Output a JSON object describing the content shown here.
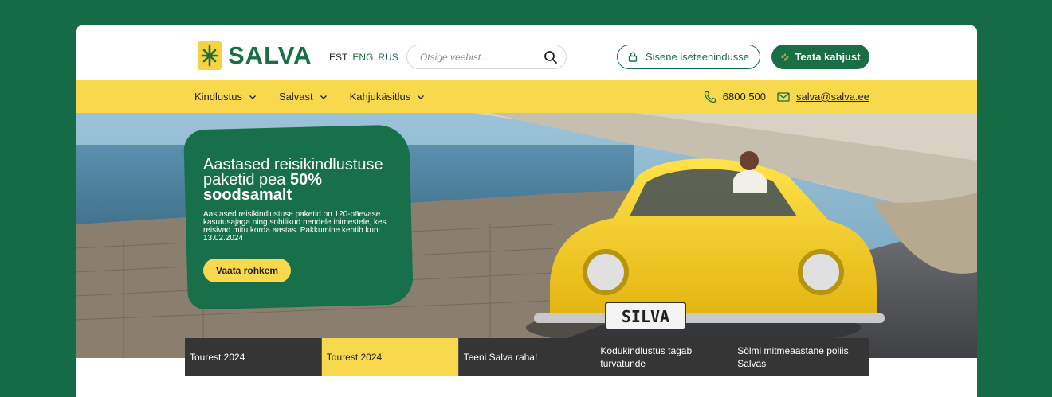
{
  "brand": {
    "name": "SALVA"
  },
  "languages": [
    {
      "label": "EST",
      "active": true
    },
    {
      "label": "ENG",
      "active": false
    },
    {
      "label": "RUS",
      "active": false
    }
  ],
  "search": {
    "placeholder": "Otsige veebist..."
  },
  "header_buttons": {
    "login": "Sisene iseteenindusse",
    "claim": "Teata kahjust"
  },
  "nav": {
    "items": [
      {
        "label": "Kindlustus"
      },
      {
        "label": "Salvast"
      },
      {
        "label": "Kahjukäsitlus"
      }
    ],
    "phone": "6800 500",
    "email": "salva@salva.ee"
  },
  "hero": {
    "title_line1": "Aastased reisikindlustuse",
    "title_line2": "paketid pea",
    "title_bold1": "50%",
    "title_bold2": "soodsamalt",
    "body": "Aastased reisikindlustuse paketid on 120-päevase kasutusajaga ning sobilikud nendele inimestele, kes reisivad mitu korda aastas. Pakkumine kehtib kuni 13.02.2024",
    "button": "Vaata rohkem",
    "plate": "SILVA"
  },
  "tabs": [
    {
      "label": "Tourest 2024",
      "active": false
    },
    {
      "label": "Tourest 2024",
      "active": true
    },
    {
      "label": "Teeni Salva raha!",
      "active": false
    },
    {
      "label": "Kodukindlustus tagab turvatunde",
      "active": false
    },
    {
      "label": "Sõlmi mitmeaastane poliis Salvas",
      "active": false
    }
  ],
  "colors": {
    "background": "#146b46",
    "brand_green": "#1a6e45",
    "brand_yellow": "#f8d84c",
    "tab_dark": "#353535"
  }
}
